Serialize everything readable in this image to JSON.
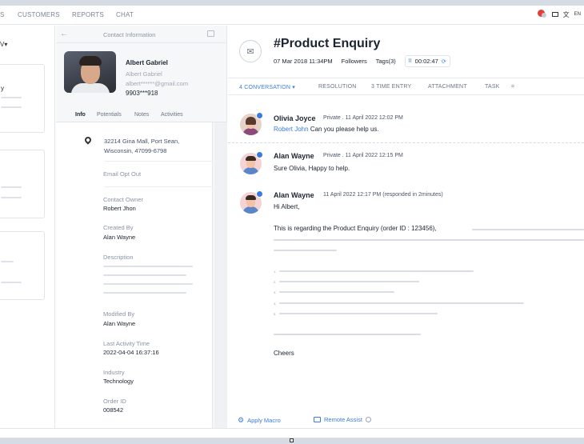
{
  "nav": {
    "items": [
      "S",
      "CUSTOMERS",
      "REPORTS",
      "CHAT"
    ],
    "right_text": "EN"
  },
  "left_list": {
    "sort_label": "V▾",
    "card_label": "y"
  },
  "contact": {
    "header_title": "Contact Information",
    "back_symbol": "←",
    "name": "Albert Gabriel",
    "sub_name": "Albert Gabriel",
    "email": "albert******@gmail.com",
    "phone": "9903***918",
    "tabs": [
      "Info",
      "Potentials",
      "Notes",
      "Activities"
    ],
    "address_line1": "32214 Gina Mall, Port Sean,",
    "address_line2": "Wisconsin, 47099-6798",
    "email_opt_out": "Email Opt Out",
    "fields": [
      {
        "label": "Contact Owner",
        "value": "Robert Jhon"
      },
      {
        "label": "Created By",
        "value": "Alan Wayne"
      },
      {
        "label": "Description",
        "value": ""
      },
      {
        "label": "Modified By",
        "value": "Alan Wayne"
      },
      {
        "label": "Last Activity Time",
        "value": "2022-04-04 16:37:16"
      },
      {
        "label": "Industry",
        "value": "Technology"
      },
      {
        "label": "Order ID",
        "value": "008542"
      }
    ]
  },
  "ticket": {
    "title": "#Product Enquiry",
    "date": "07 Mar 2018 11:34PM",
    "followers": "Followers",
    "tags": "Tags(3)",
    "pause_symbol": "II",
    "timer": "00:02:47",
    "refresh_symbol": "⟳"
  },
  "main_tabs": [
    {
      "label": "4 CONVERSATION ▾"
    },
    {
      "label": "RESOLUTION"
    },
    {
      "label": "3 TIME ENTRY"
    },
    {
      "label": "ATTACHMENT"
    },
    {
      "label": "TASK"
    },
    {
      "label": "="
    }
  ],
  "messages": [
    {
      "name": "Olivia Joyce",
      "meta": "Private . 11 April 2022  12:02 PM",
      "mention": "Robert John",
      "text": " Can you please help us."
    },
    {
      "name": "Alan Wayne",
      "meta": "Private . 11 April 2022  12:15 PM",
      "text": "Sure Olivia, Happy to help."
    },
    {
      "name": "Alan Wayne",
      "meta": "11 April 2022  12:17 PM  (responded in 2minutes)",
      "greeting": "Hi Albert,",
      "body": "This is regarding the Product Enquiry (order ID : 123456),",
      "list_numbers": [
        "1.",
        "2.",
        "3.",
        "4.",
        "5."
      ],
      "closing": "Cheers"
    }
  ],
  "bottom": {
    "apply_macro": "Apply Macro",
    "remote_assist": "Remote Assist"
  },
  "colors": {
    "accent": "#3a7be0",
    "alert": "#e0403a"
  },
  "icons": {
    "ticket": "envelope-icon",
    "pin": "location-pin-icon",
    "macro": "macro-icon",
    "remote": "monitor-icon",
    "info": "info-icon"
  }
}
